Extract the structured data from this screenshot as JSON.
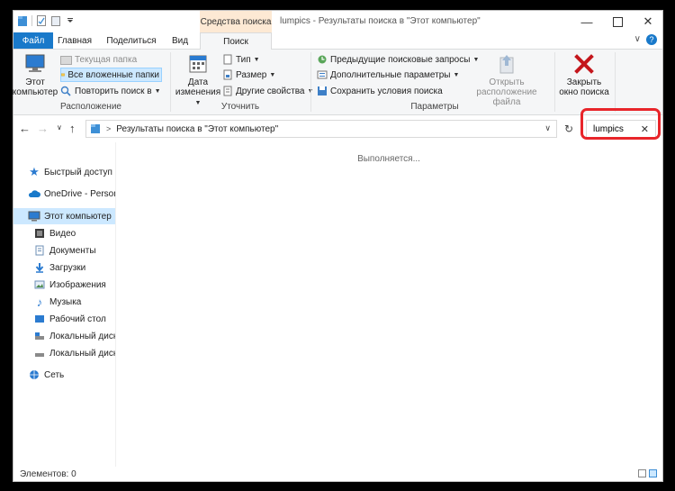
{
  "window": {
    "title": "lumpics - Результаты поиска в \"Этот компьютер\"",
    "context_tab": "Средства поиска"
  },
  "tabs": {
    "file": "Файл",
    "home": "Главная",
    "share": "Поделиться",
    "view": "Вид",
    "search": "Поиск"
  },
  "ribbon": {
    "location": {
      "this_pc_line1": "Этот",
      "this_pc_line2": "компьютер",
      "current_folder": "Текущая папка",
      "all_subfolders": "Все вложенные папки",
      "search_again": "Повторить поиск в",
      "group": "Расположение"
    },
    "refine": {
      "date_line1": "Дата",
      "date_line2": "изменения",
      "type": "Тип",
      "size": "Размер",
      "other": "Другие свойства",
      "group": "Уточнить"
    },
    "options": {
      "recent": "Предыдущие поисковые запросы",
      "advanced": "Дополнительные параметры",
      "save": "Сохранить условия поиска",
      "open_line1": "Открыть",
      "open_line2": "расположение файла",
      "group": "Параметры"
    },
    "close": {
      "line1": "Закрыть",
      "line2": "окно поиска"
    }
  },
  "address": {
    "path": "Результаты поиска в \"Этот компьютер\"",
    "search_value": "lumpics"
  },
  "nav": {
    "quick_access": "Быстрый доступ",
    "onedrive": "OneDrive - Persona",
    "this_pc": "Этот компьютер",
    "video": "Видео",
    "documents": "Документы",
    "downloads": "Загрузки",
    "pictures": "Изображения",
    "music": "Музыка",
    "desktop": "Рабочий стол",
    "disk1": "Локальный диск",
    "disk2": "Локальный диск",
    "network": "Сеть"
  },
  "content": {
    "status": "Выполняется..."
  },
  "statusbar": {
    "items": "Элементов: 0"
  },
  "colors": {
    "accent": "#1979ca",
    "context_tab_bg": "#fde9d4",
    "selection": "#cce8ff",
    "highlight_frame": "#e8252a",
    "close_x": "#c4161c"
  }
}
